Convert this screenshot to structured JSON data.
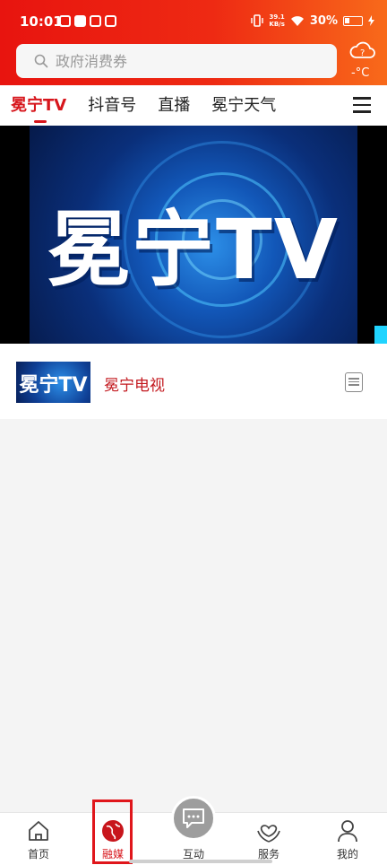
{
  "status_bar": {
    "time": "10:01",
    "net_speed_top": "39.1",
    "net_speed_bottom": "KB/s",
    "battery": "30%"
  },
  "search": {
    "placeholder": "政府消费券"
  },
  "weather": {
    "temp": "-°C",
    "icon": "cloud-question-icon"
  },
  "tabs": [
    {
      "label": "冕宁TV",
      "active": true
    },
    {
      "label": "抖音号"
    },
    {
      "label": "直播"
    },
    {
      "label": "冕宁天气"
    }
  ],
  "video": {
    "title": "冕宁TV"
  },
  "channel": {
    "thumb_text": "冕宁TV",
    "name": "冕宁电视"
  },
  "bottom_nav": {
    "home": "首页",
    "media": "融媒",
    "interact": "互动",
    "service": "服务",
    "mine": "我的"
  },
  "colors": {
    "accent": "#d7161c",
    "header_red": "#e8140f",
    "header_orange": "#f86a1a"
  }
}
